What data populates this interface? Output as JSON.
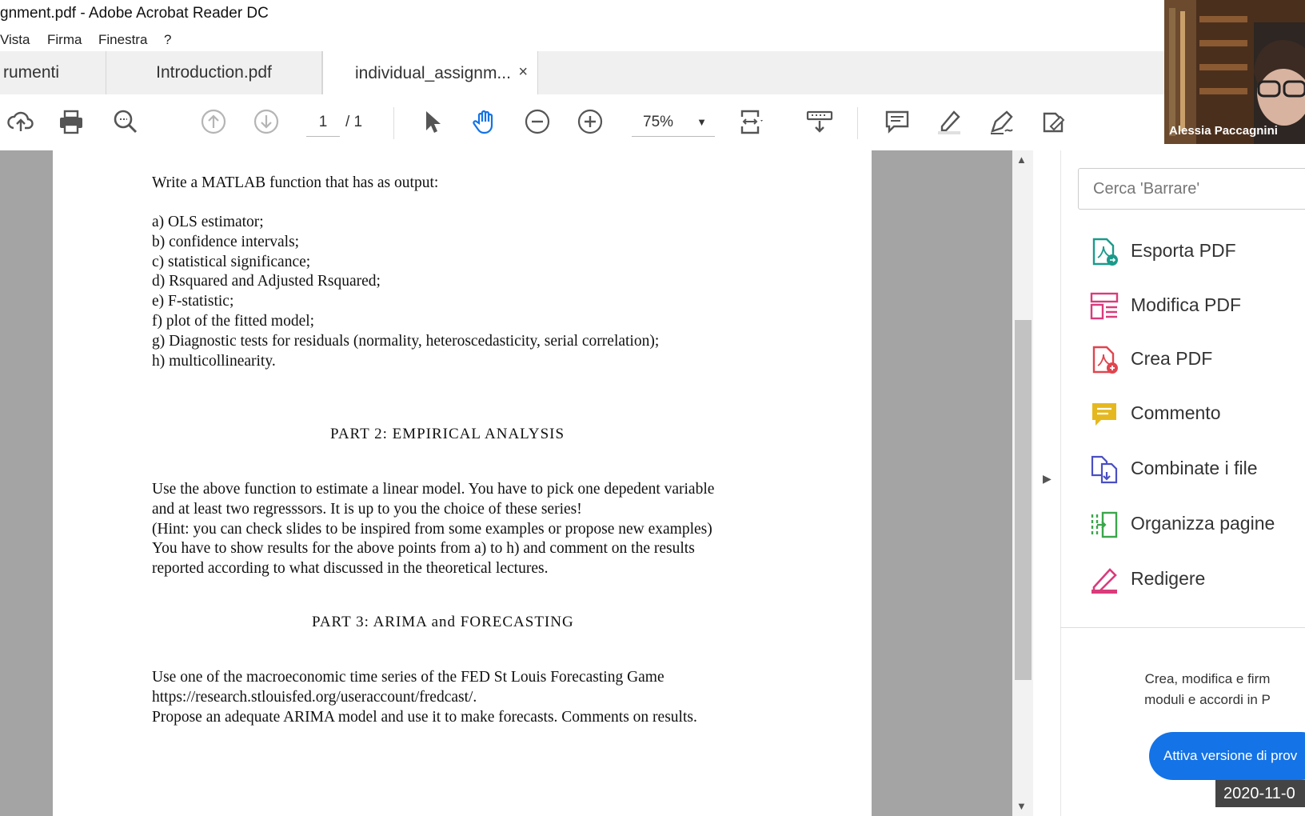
{
  "window": {
    "title": "gnment.pdf - Adobe Acrobat Reader DC"
  },
  "menu": [
    "Vista",
    "Firma",
    "Finestra",
    "?"
  ],
  "tabs": [
    {
      "label": "rumenti"
    },
    {
      "label": "Introduction.pdf"
    },
    {
      "label": "individual_assignm...",
      "close": "×"
    }
  ],
  "toolbar": {
    "page_current": "1",
    "page_total": "/ 1",
    "zoom": "75%"
  },
  "document": {
    "intro": "Write a MATLAB function that has as output:",
    "items": [
      "a) OLS estimator;",
      "b) confidence intervals;",
      "c) statistical significance;",
      "d) Rsquared and Adjusted Rsquared;",
      "e) F-statistic;",
      "f) plot of the fitted model;",
      "g) Diagnostic tests for residuals (normality, heteroscedasticity, serial correlation);",
      "h) multicollinearity."
    ],
    "part2_heading": "PART 2: EMPIRICAL ANALYSIS",
    "part2_lines": [
      "Use the above function to estimate a linear model. You have to pick one depedent variable",
      "and at least two regresssors. It is up to you the choice of these series!",
      "(Hint: you can check slides to be inspired from some examples or propose new examples)",
      "You have to show results for the above points from a) to h) and comment on the results",
      "reported according to what discussed in the theoretical lectures."
    ],
    "part3_heading": "PART 3: ARIMA and FORECASTING",
    "part3_lines": [
      "Use one of the macroeconomic time series of the FED St Louis Forecasting Game",
      "https://research.stlouisfed.org/useraccount/fredcast/.",
      "Propose an adequate ARIMA model and use it to make forecasts. Comments on results."
    ]
  },
  "right_panel": {
    "search_placeholder": "Cerca 'Barrare'",
    "tools": [
      {
        "label": "Esporta PDF",
        "icon": "export-pdf-icon",
        "color": "#1b9a8b"
      },
      {
        "label": "Modifica PDF",
        "icon": "edit-pdf-icon",
        "color": "#d93b7b"
      },
      {
        "label": "Crea PDF",
        "icon": "create-pdf-icon",
        "color": "#e0454e"
      },
      {
        "label": "Commento",
        "icon": "comment-icon",
        "color": "#e6b820"
      },
      {
        "label": "Combinate i file",
        "icon": "combine-files-icon",
        "color": "#4a4fc4"
      },
      {
        "label": "Organizza pagine",
        "icon": "organize-pages-icon",
        "color": "#3aa64b"
      },
      {
        "label": "Redigere",
        "icon": "redact-icon",
        "color": "#d93b7b"
      }
    ],
    "promo_line1": "Crea, modifica e firm",
    "promo_line2": "moduli e accordi in P",
    "trial_button": "Attiva versione di prov"
  },
  "video": {
    "participant_name": "Alessia Paccagnini"
  },
  "timestamp": "2020-11-0"
}
